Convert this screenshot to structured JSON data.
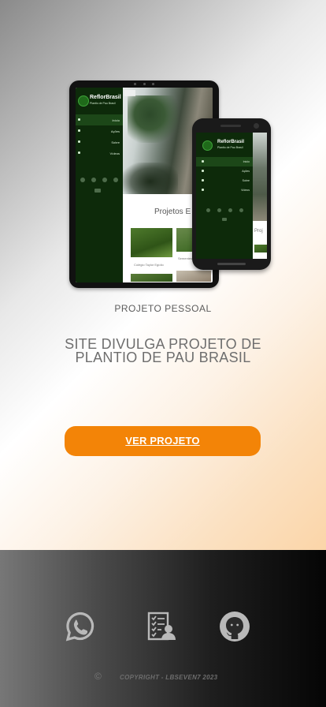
{
  "hero": {
    "mockup": {
      "tablet": {
        "brand": "ReflorBrasil",
        "brand_sub": "Plantio de Pau Brasil",
        "menu": [
          {
            "label": "Início",
            "active": true
          },
          {
            "label": "Ações",
            "active": false
          },
          {
            "label": "Sobre",
            "active": false
          },
          {
            "label": "Vídeos",
            "active": false
          }
        ],
        "section_title": "Projetos E",
        "card1_label": "Colégio Taylor Egídio",
        "card2_label": "Sementes"
      },
      "phone": {
        "brand": "ReflorBrasil",
        "brand_sub": "Plantio de Pau Brasil",
        "menu": [
          {
            "label": "Início",
            "active": true
          },
          {
            "label": "Ações",
            "active": false
          },
          {
            "label": "Sobre",
            "active": false
          },
          {
            "label": "Vídeos",
            "active": false
          }
        ],
        "section_title": "Proj"
      }
    },
    "kicker": "PROJETO PESSOAL",
    "title": "SITE DIVULGA PROJETO DE PLANTIO DE PAU BRASIL",
    "cta_label": "VER PROJETO"
  },
  "footer": {
    "icons": [
      "whatsapp-icon",
      "resume-icon",
      "github-icon"
    ],
    "copyright_symbol": "©",
    "copyright_text": "COPYRIGHT - LBSEVEN7 2023"
  },
  "colors": {
    "accent": "#f38407",
    "sidebar_green": "#0d2a0a",
    "text_gray": "#6e6e6e"
  }
}
